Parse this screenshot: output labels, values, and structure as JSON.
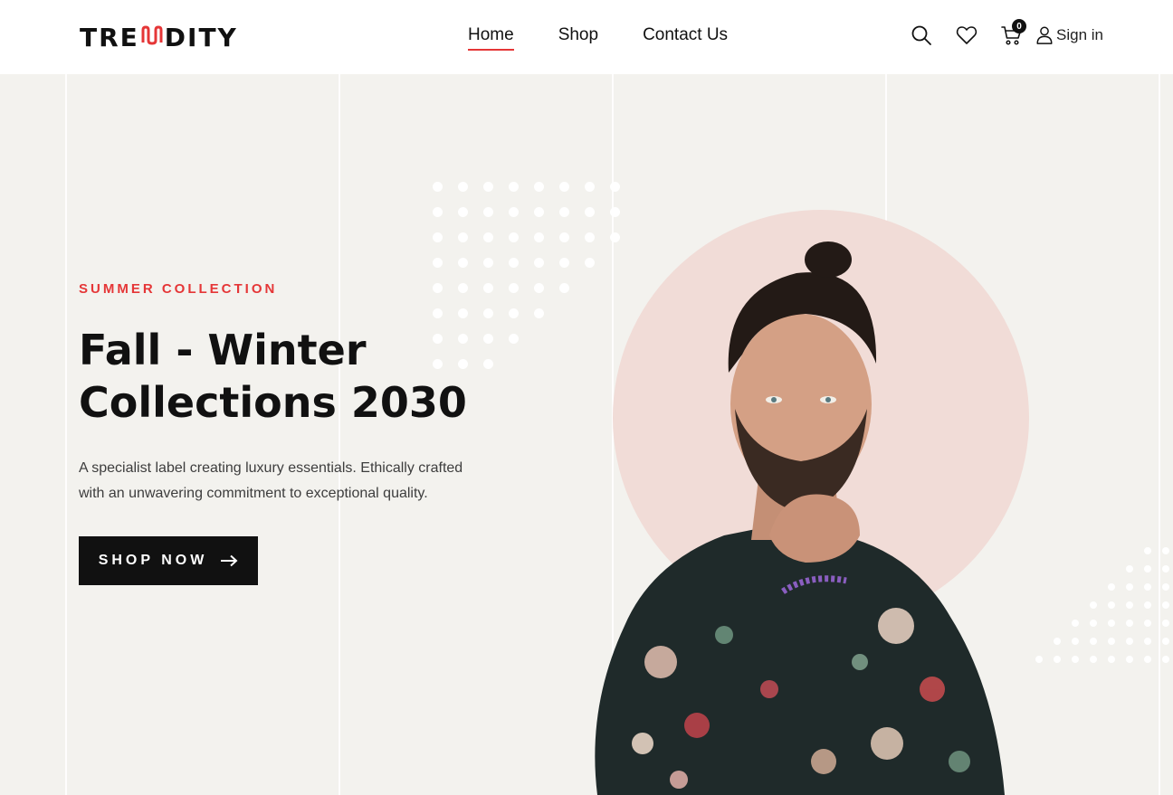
{
  "brand": {
    "logo_left": "TRE",
    "logo_mark": "ꟽ",
    "logo_right": "DITY",
    "logo_alt": "TRENDITY"
  },
  "nav": {
    "items": [
      {
        "label": "Home",
        "active": true
      },
      {
        "label": "Shop",
        "active": false
      },
      {
        "label": "Contact Us",
        "active": false
      }
    ]
  },
  "header_icons": {
    "search": "search-icon",
    "wishlist": "heart-icon",
    "cart": "cart-icon",
    "cart_count": "0",
    "user": "user-icon",
    "signin_label": "Sign in"
  },
  "hero": {
    "eyebrow": "SUMMER COLLECTION",
    "title": "Fall - Winter Collections 2030",
    "description": "A specialist label creating luxury essentials. Ethically crafted with an unwavering commitment to exceptional quality.",
    "cta_label": "SHOP NOW",
    "cta_icon": "arrow-right-icon"
  },
  "colors": {
    "accent": "#e53637",
    "background": "#f3f2ee",
    "header": "#ffffff",
    "circle": "#f1dcd7",
    "button": "#111111"
  }
}
